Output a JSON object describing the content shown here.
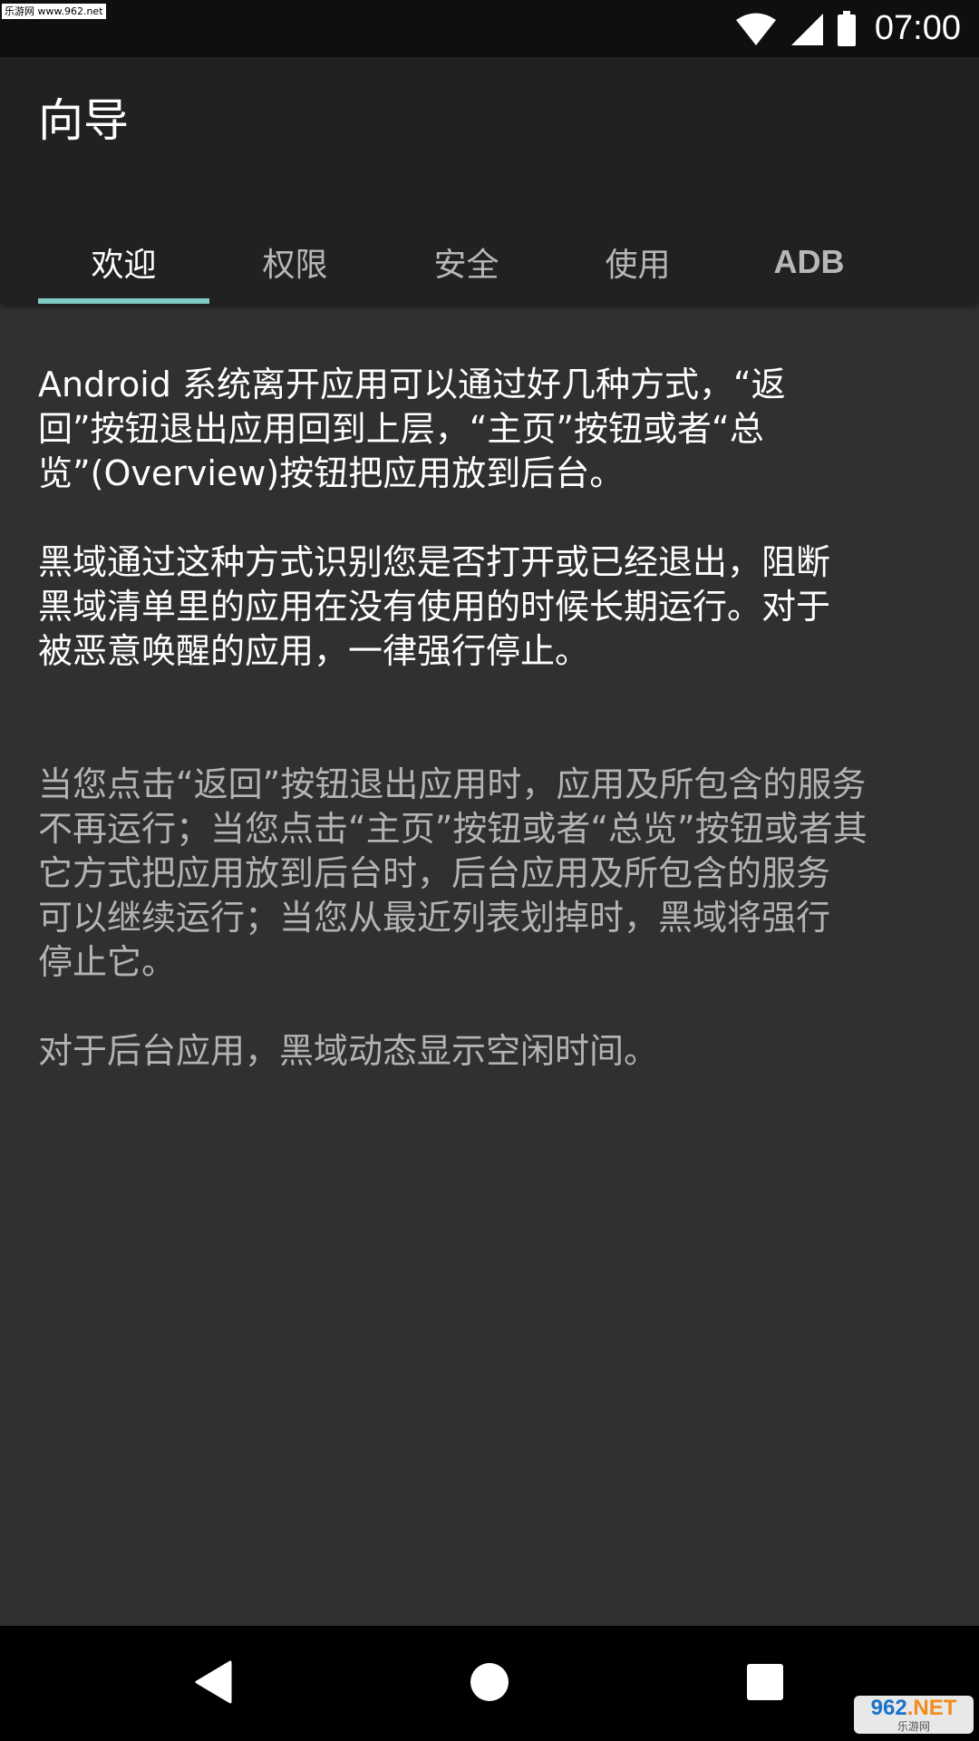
{
  "status_bar": {
    "watermark": "乐游网 www.962.net",
    "time": "07:00",
    "icons": [
      "wifi-icon",
      "signal-icon",
      "battery-icon"
    ]
  },
  "toolbar": {
    "title": "向导"
  },
  "tabs": [
    {
      "label": "欢迎",
      "active": true
    },
    {
      "label": "权限",
      "active": false
    },
    {
      "label": "安全",
      "active": false
    },
    {
      "label": "使用",
      "active": false
    },
    {
      "label": "ADB",
      "active": false
    }
  ],
  "content": {
    "paragraph_1": "Android 系统离开应用可以通过好几种方式，“返\n回”按钮退出应用回到上层，“主页”按钮或者“总\n览”(Overview)按钮把应用放到后台。",
    "paragraph_2": "黑域通过这种方式识别您是否打开或已经退出，阻断\n黑域清单里的应用在没有使用的时候长期运行。对于\n被恶意唤醒的应用，一律强行停止。",
    "paragraph_3": "当您点击“返回”按钮退出应用时，应用及所包含的服务\n不再运行；当您点击“主页”按钮或者“总览”按钮或者其\n它方式把应用放到后台时，后台应用及所包含的服务\n可以继续运行；当您从最近列表划掉时，黑域将强行\n停止它。",
    "paragraph_4": "对于后台应用，黑域动态显示空闲时间。"
  },
  "nav_bar": {
    "buttons": [
      "back-icon",
      "home-icon",
      "recents-icon"
    ]
  },
  "watermark_bottom": {
    "logo_main": "962",
    "logo_suffix": ".NET",
    "sub": "乐游网"
  },
  "colors": {
    "status_bar_bg": "#0f0f0f",
    "toolbar_bg": "#212121",
    "content_bg": "#303030",
    "tab_indicator": "#80cbc4",
    "primary_text": "#ffffff",
    "secondary_text": "#b3b3b3",
    "nav_bar_bg": "#000000"
  }
}
